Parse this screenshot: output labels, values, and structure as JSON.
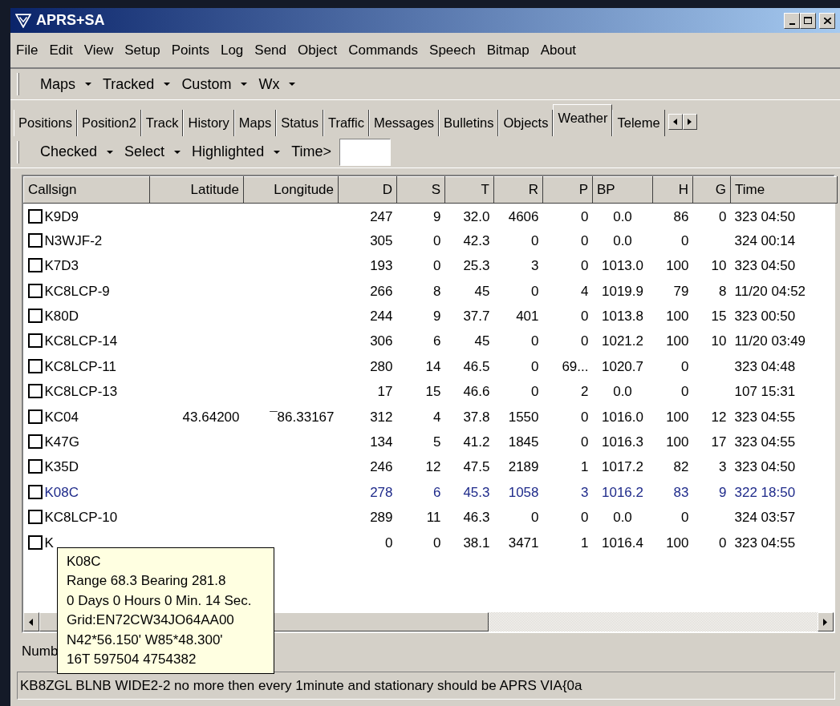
{
  "window": {
    "title": "APRS+SA"
  },
  "menu": [
    "File",
    "Edit",
    "View",
    "Setup",
    "Points",
    "Log",
    "Send",
    "Object",
    "Commands",
    "Speech",
    "Bitmap",
    "About"
  ],
  "toolbar": [
    "Maps",
    "Tracked",
    "Custom",
    "Wx"
  ],
  "tabs": [
    {
      "label": "Positions",
      "selected": false
    },
    {
      "label": "Position2",
      "selected": false
    },
    {
      "label": "Track",
      "selected": false
    },
    {
      "label": "History",
      "selected": false
    },
    {
      "label": "Maps",
      "selected": false
    },
    {
      "label": "Status",
      "selected": false
    },
    {
      "label": "Traffic",
      "selected": false
    },
    {
      "label": "Messages",
      "selected": false
    },
    {
      "label": "Bulletins",
      "selected": false
    },
    {
      "label": "Objects",
      "selected": false
    },
    {
      "label": "Weather",
      "selected": true
    },
    {
      "label": "Teleme",
      "selected": false
    }
  ],
  "filter_bar": {
    "dropdowns": [
      "Checked",
      "Select",
      "Highlighted"
    ],
    "time_label": "Time>"
  },
  "table": {
    "columns": [
      "Callsign",
      "Latitude",
      "Longitude",
      "D",
      "S",
      "T",
      "R",
      "P",
      "BP",
      "H",
      "G",
      "Time"
    ],
    "rows": [
      {
        "cells": [
          "K9D9",
          "",
          "",
          "247",
          "9",
          "32.0",
          "4606",
          "0",
          "0.0",
          "86",
          "0",
          "323 04:50"
        ],
        "checked": false,
        "highlighted": false
      },
      {
        "cells": [
          "N3WJF-2",
          "",
          "",
          "305",
          "0",
          "42.3",
          "0",
          "0",
          "0.0",
          "0",
          "",
          "324 00:14"
        ],
        "checked": false,
        "highlighted": false
      },
      {
        "cells": [
          "K7D3",
          "",
          "",
          "193",
          "0",
          "25.3",
          "3",
          "0",
          "1013.0",
          "100",
          "10",
          "323 04:50"
        ],
        "checked": false,
        "highlighted": false
      },
      {
        "cells": [
          "KC8LCP-9",
          "",
          "",
          "266",
          "8",
          "45",
          "0",
          "4",
          "1019.9",
          "79",
          "8",
          "11/20 04:52"
        ],
        "checked": false,
        "highlighted": false
      },
      {
        "cells": [
          "K80D",
          "",
          "",
          "244",
          "9",
          "37.7",
          "401",
          "0",
          "1013.8",
          "100",
          "15",
          "323 00:50"
        ],
        "checked": false,
        "highlighted": false
      },
      {
        "cells": [
          "KC8LCP-14",
          "",
          "",
          "306",
          "6",
          "45",
          "0",
          "0",
          "1021.2",
          "100",
          "10",
          "11/20 03:49"
        ],
        "checked": false,
        "highlighted": false
      },
      {
        "cells": [
          "KC8LCP-11",
          "",
          "",
          "280",
          "14",
          "46.5",
          "0",
          "69...",
          "1020.7",
          "0",
          "",
          "323 04:48"
        ],
        "checked": false,
        "highlighted": false
      },
      {
        "cells": [
          "KC8LCP-13",
          "",
          "",
          "17",
          "15",
          "46.6",
          "0",
          "2",
          "0.0",
          "0",
          "",
          "107 15:31"
        ],
        "checked": false,
        "highlighted": false
      },
      {
        "cells": [
          "KC04",
          "43.64200",
          "¯86.33167",
          "312",
          "4",
          "37.8",
          "1550",
          "0",
          "1016.0",
          "100",
          "12",
          "323 04:55"
        ],
        "checked": false,
        "highlighted": false
      },
      {
        "cells": [
          "K47G",
          "",
          "",
          "134",
          "5",
          "41.2",
          "1845",
          "0",
          "1016.3",
          "100",
          "17",
          "323 04:55"
        ],
        "checked": false,
        "highlighted": false
      },
      {
        "cells": [
          "K35D",
          "",
          "",
          "246",
          "12",
          "47.5",
          "2189",
          "1",
          "1017.2",
          "82",
          "3",
          "323 04:50"
        ],
        "checked": false,
        "highlighted": false
      },
      {
        "cells": [
          "K08C",
          "",
          "",
          "278",
          "6",
          "45.3",
          "1058",
          "3",
          "1016.2",
          "83",
          "9",
          "322 18:50"
        ],
        "checked": false,
        "highlighted": true
      },
      {
        "cells": [
          "KC8LCP-10",
          "",
          "",
          "289",
          "11",
          "46.3",
          "0",
          "0",
          "0.0",
          "0",
          "",
          "324 03:57"
        ],
        "checked": false,
        "highlighted": false
      },
      {
        "cells": [
          "K",
          "",
          "",
          "0",
          "0",
          "38.1",
          "3471",
          "1",
          "1016.4",
          "100",
          "0",
          "323 04:55"
        ],
        "checked": false,
        "highlighted": false
      }
    ]
  },
  "tooltip": [
    "K08C",
    "Range 68.3 Bearing 281.8",
    "0 Days 0 Hours 0 Min. 14 Sec.",
    "Grid:EN72CW34JO64AA00",
    "N42*56.150' W85*48.300'",
    "16T 597504 4754382"
  ],
  "status_label": "Numb",
  "status_bar": "KB8ZGL BLNB WIDE2-2 no more then every 1minute and stationary should be APRS VIA{0a"
}
